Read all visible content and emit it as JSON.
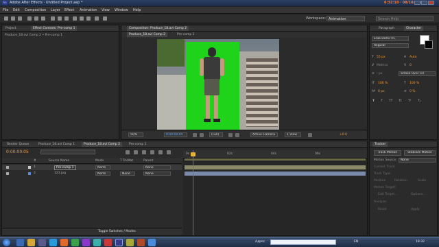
{
  "window": {
    "title": "Adobe After Effects - Untitled Project.aep *",
    "clock": "6:32:18 · 08/10/2013"
  },
  "menu": [
    "File",
    "Edit",
    "Composition",
    "Layer",
    "Effect",
    "Animation",
    "View",
    "Window",
    "Help"
  ],
  "toolbar": {
    "workspace_label": "Workspace:",
    "workspace_value": "Animation",
    "search_placeholder": "Search Help"
  },
  "project_panel": {
    "tabs": [
      "Project",
      "Effect Controls: Pre-comp 1"
    ],
    "breadcrumb": "Produce_18.avi Comp 2 • Pre-comp 1"
  },
  "composition_panel": {
    "title_tab": "Composition: Produce_18.avi Comp 2",
    "subtabs": [
      "Produce_18.avi Comp 2",
      "Pre-comp 1"
    ],
    "zoom": "50%",
    "timecode": "0:00:00:05",
    "resolution": "(Full)",
    "camera": "Active Camera",
    "views": "1 View",
    "exposure": "+0.0"
  },
  "character_panel": {
    "tabs": [
      "Paragraph",
      "Character"
    ],
    "font": "Eras Demi ITC",
    "style": "Regular",
    "size": "55 px",
    "tracking": "Auto",
    "stroke": "Stroke Over Fill",
    "scale_v": "100 %",
    "scale_h": "100 %",
    "baseline": "0 px",
    "tsume": "0 %",
    "fill_color": "#ffffff",
    "stroke_color": "#000000"
  },
  "timeline": {
    "tabs": [
      "Render Queue",
      "Produce_18.avi Comp 1",
      "Produce_18.avi Comp 2",
      "Pre-comp 1"
    ],
    "timecode": "0:00:00:05",
    "search_placeholder": "",
    "columns": [
      "#",
      "Source Name",
      "Mode",
      "T TrkMat",
      "Parent"
    ],
    "layers": [
      {
        "num": "1",
        "name": "Pre-comp 1",
        "mode": "Norm",
        "trkmat": "",
        "parent": "None",
        "color": "#c9c9c9"
      },
      {
        "num": "2",
        "name": "123.jpg",
        "mode": "Norm",
        "trkmat": "None",
        "parent": "None",
        "color": "#5a8ad8"
      }
    ],
    "ruler": [
      "0s",
      "02s",
      "04s",
      "06s"
    ],
    "toggle_label": "Toggle Switches / Modes"
  },
  "tracker_panel": {
    "tab": "Tracker",
    "buttons": [
      "Track Motion",
      "Stabilize Motion"
    ],
    "motion_source_label": "Motion Source:",
    "motion_source": "None",
    "current_track": "Current Track:",
    "track_type": "Track Type:",
    "position": "Position",
    "rotation": "Rotation",
    "scale": "Scale",
    "motion_target": "Motion Target:",
    "edit_target": "Edit Target...",
    "options": "Options...",
    "analyze": "Analyze:",
    "reset": "Reset",
    "apply": "Apply"
  },
  "taskbar": {
    "address_label": "Адрес",
    "lang": "EN",
    "time": "18:32"
  },
  "colors": {
    "accent_orange": "#ff9a2a",
    "greenscreen": "#1fd21a",
    "timeline_bar": "#8a8a6a",
    "playhead": "#e34a2a"
  }
}
